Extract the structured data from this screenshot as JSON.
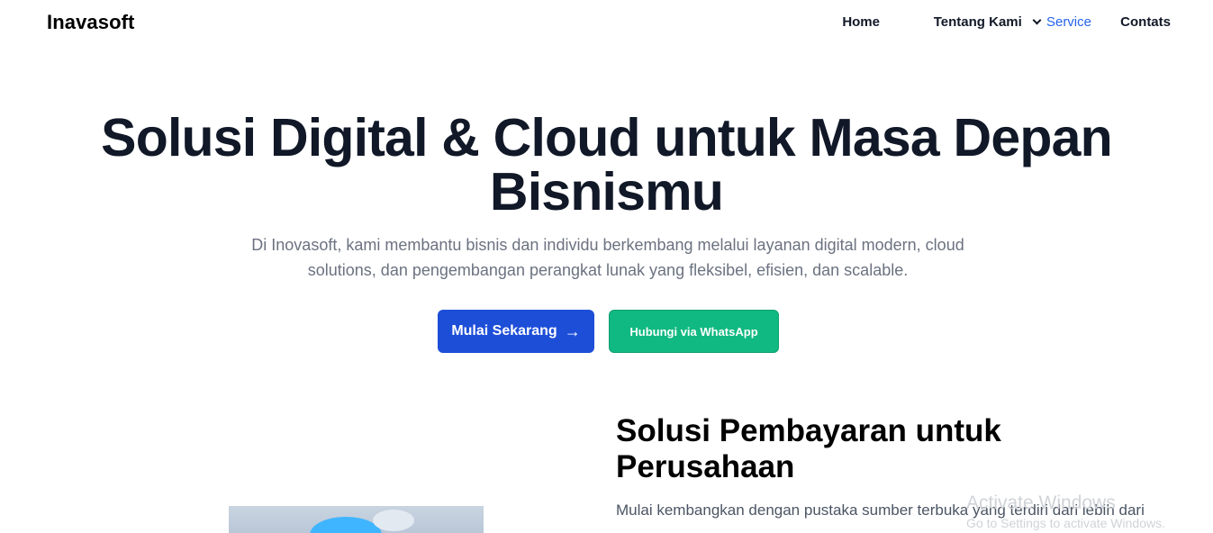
{
  "header": {
    "brand": "Inavasoft",
    "nav": {
      "home": "Home",
      "about": "Tentang Kami",
      "service": "Service",
      "contact": "Contats"
    }
  },
  "hero": {
    "title_line1": "Solusi Digital & Cloud untuk Masa Depan",
    "title_line2": "Bisnismu",
    "description": "Di Inovasoft, kami membantu bisnis dan individu berkembang melalui layanan digital modern, cloud solutions, dan pengembangan perangkat lunak yang fleksibel, efisien, dan scalable.",
    "primary_button": "Mulai Sekarang",
    "primary_button_icon": "arrow-right-icon",
    "secondary_button": "Hubungi via WhatsApp"
  },
  "feature": {
    "title": "Solusi Pembayaran untuk Perusahaan",
    "description": "Mulai kembangkan dengan pustaka sumber terbuka yang terdiri dari lebih dari"
  },
  "watermark": {
    "title": "Activate Windows",
    "subtitle": "Go to Settings to activate Windows."
  },
  "colors": {
    "primary": "#1d4ed8",
    "secondary": "#10b981",
    "active_nav": "#2563eb"
  }
}
